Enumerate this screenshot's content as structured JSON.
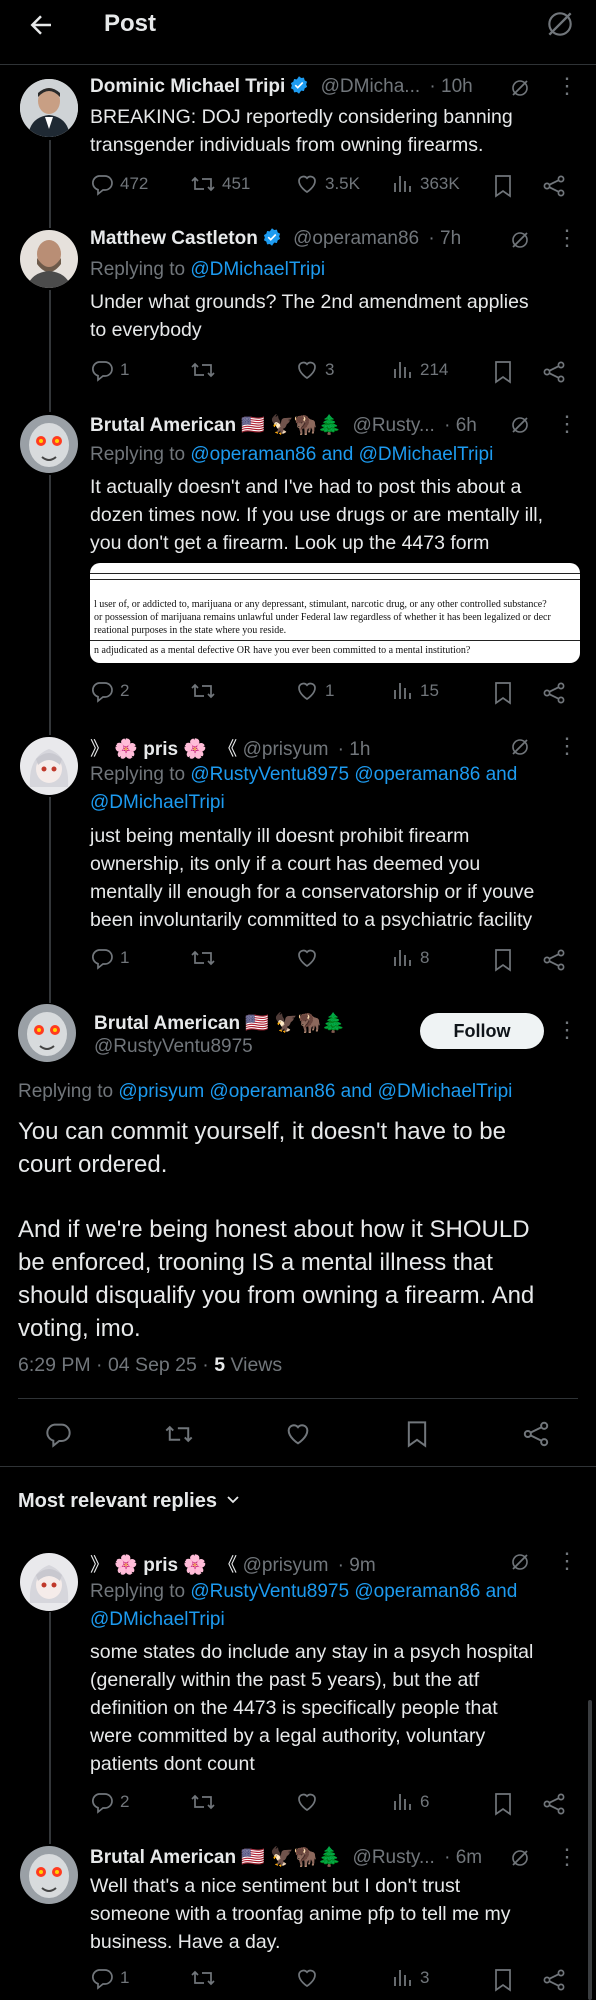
{
  "header": {
    "title": "Post",
    "back_icon": "arrow-left-icon",
    "grok_icon": "grok-icon"
  },
  "colors": {
    "accent": "#1d9bf0",
    "muted": "#71767b",
    "text": "#e7e9ea",
    "bg": "#000000",
    "follow_bg": "#eff3f4"
  },
  "tweets": [
    {
      "name": "Dominic Michael Tripi",
      "handle": "@DMicha...",
      "time": "· 10h",
      "verified": true,
      "body": [
        "BREAKING: DOJ reportedly considering banning",
        "transgender individuals from owning firearms."
      ],
      "stats": {
        "replies": "472",
        "reposts": "451",
        "likes": "3.5K",
        "views": "363K"
      }
    },
    {
      "name": "Matthew Castleton",
      "handle": "@operaman86",
      "time": "· 7h",
      "verified": true,
      "replying": "@DMichaelTripi",
      "body": [
        "Under what grounds? The 2nd amendment applies",
        "to everybody"
      ],
      "stats": {
        "replies": "1",
        "reposts": "",
        "likes": "3",
        "views": "214"
      }
    },
    {
      "name": "Brutal American 🇺🇸 🦅🦬🌲",
      "handle": "@Rusty...",
      "time": "· 6h",
      "replying": "@operaman86 and @DMichaelTripi",
      "body": [
        "It actually doesn't and I've had to post this about a",
        "dozen times now. If you use drugs or are mentally ill,",
        "you don't get a firearm. Look up the 4473 form"
      ],
      "stats": {
        "replies": "2",
        "reposts": "",
        "likes": "1",
        "views": "15"
      }
    },
    {
      "name": "🌸 pris 🌸",
      "prefix": "》",
      "suffix": "《",
      "handle": "@prisyum",
      "time": "· 1h",
      "replying_lines": [
        "@RustyVentu8975 @operaman86 and",
        "@DMichaelTripi"
      ],
      "body": [
        "just being mentally ill doesnt prohibit firearm",
        "ownership, its only if a court has deemed you",
        "mentally ill enough for a conservatorship or if youve",
        "been involuntarily committed to a psychiatric facility"
      ],
      "stats": {
        "replies": "1",
        "reposts": "",
        "likes": "",
        "views": "8"
      }
    }
  ],
  "form_image": {
    "lines": [
      "l user of, or addicted to, marijuana or any depressant, stimulant, narcotic drug, or any other controlled substance?",
      "or possession of marijuana remains unlawful under Federal law regardless of whether it has been legalized or decr",
      "reational purposes in the state where you reside.",
      "n adjudicated as a mental defective OR have you ever been committed to a mental institution?"
    ]
  },
  "main_post": {
    "name": "Brutal American 🇺🇸 🦅🦬🌲",
    "handle": "@RustyVentu8975",
    "follow_label": "Follow",
    "replying_prefix": "Replying to",
    "replying": "@prisyum @operaman86 and @DMichaelTripi",
    "paragraphs": [
      [
        "You can commit yourself, it doesn't have to be",
        "court ordered."
      ],
      [
        "And if we're being honest about how it SHOULD",
        "be enforced, trooning IS a mental illness that",
        "should disqualify you from owning a firearm. And",
        "voting, imo."
      ]
    ],
    "timestamp": "6:29 PM · 04 Sep 25 · ",
    "views_count": "5",
    "views_label": " Views"
  },
  "sort_label": "Most relevant replies",
  "replies": [
    {
      "name": "🌸 pris 🌸",
      "prefix": "》",
      "suffix": "《",
      "handle": "@prisyum",
      "time": "· 9m",
      "replying_lines": [
        "@RustyVentu8975 @operaman86 and",
        "@DMichaelTripi"
      ],
      "body": [
        "some states do include any stay in a psych hospital",
        "(generally within the past 5 years), but the atf",
        "definition on the 4473 is specifically people that",
        "were committed by a legal authority, voluntary",
        "patients dont count"
      ],
      "stats": {
        "replies": "2",
        "reposts": "",
        "likes": "",
        "views": "6"
      }
    },
    {
      "name": "Brutal American 🇺🇸 🦅🦬🌲",
      "handle": "@Rusty...",
      "time": "· 6m",
      "body": [
        "Well that's a nice sentiment but I don't trust",
        "someone with a troonfag anime pfp to tell me my",
        "business. Have a day."
      ],
      "stats": {
        "replies": "1",
        "reposts": "",
        "likes": "",
        "views": "3"
      }
    }
  ],
  "replying_prefix": "Replying to"
}
